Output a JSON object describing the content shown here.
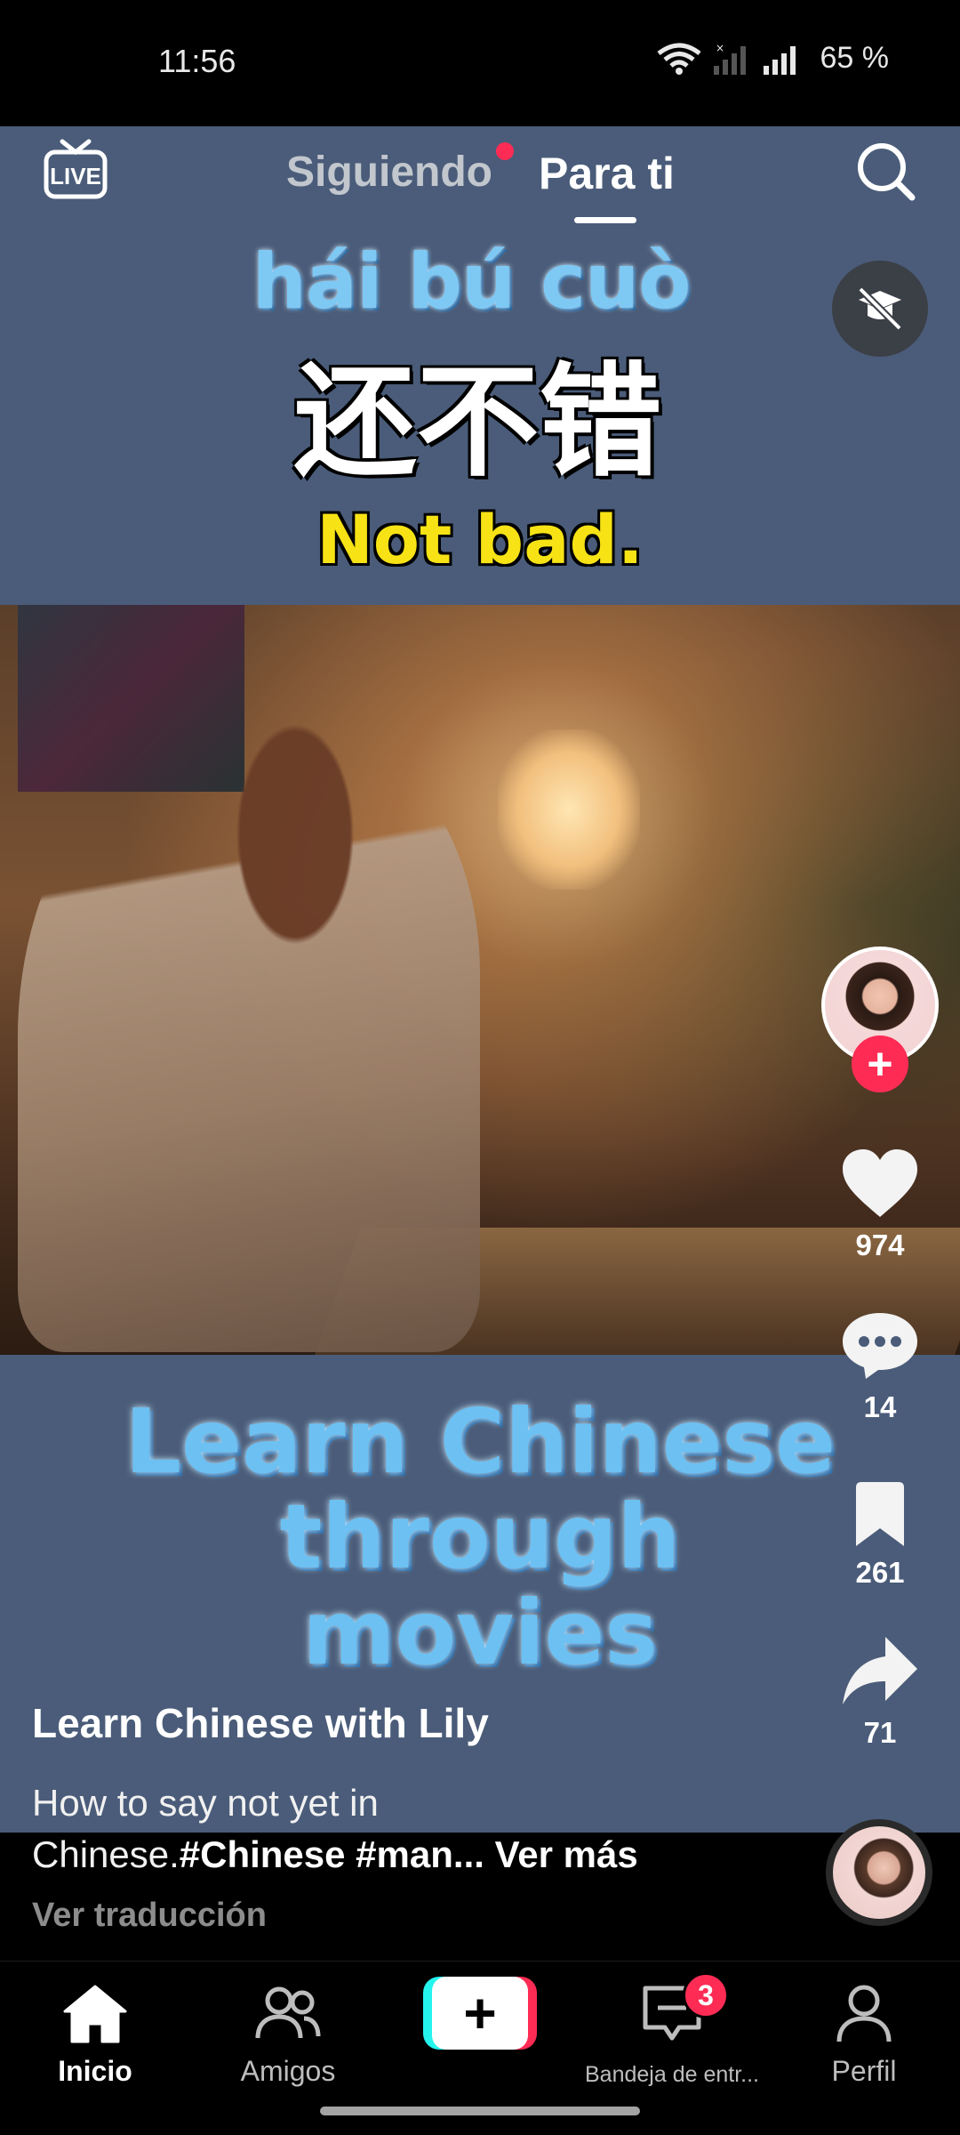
{
  "status_bar": {
    "time": "11:56",
    "battery": "65 %"
  },
  "top_nav": {
    "live_label": "LIVE",
    "tab_following": "Siguiendo",
    "tab_for_you": "Para ti"
  },
  "video": {
    "pinyin": "hái bú cuò",
    "hanzi": "还不错",
    "translation": "Not bad.",
    "promo_line1": "Learn Chinese",
    "promo_line2": "through movies"
  },
  "actions": {
    "likes": "974",
    "comments": "14",
    "saves": "261",
    "shares": "71"
  },
  "caption": {
    "author": "Learn Chinese with Lily",
    "line1": "How to say not yet in",
    "line2_prefix": "Chinese.",
    "line2_tags": "#Chinese #man...",
    "see_more": "Ver más",
    "translate": "Ver traducción"
  },
  "bottom_nav": {
    "home": "Inicio",
    "friends": "Amigos",
    "inbox": "Bandeja de entr...",
    "inbox_badge": "3",
    "profile": "Perfil"
  },
  "colors": {
    "accent": "#fe2c55",
    "cyan": "#25f4ee",
    "video_bg": "#4a5c79"
  }
}
